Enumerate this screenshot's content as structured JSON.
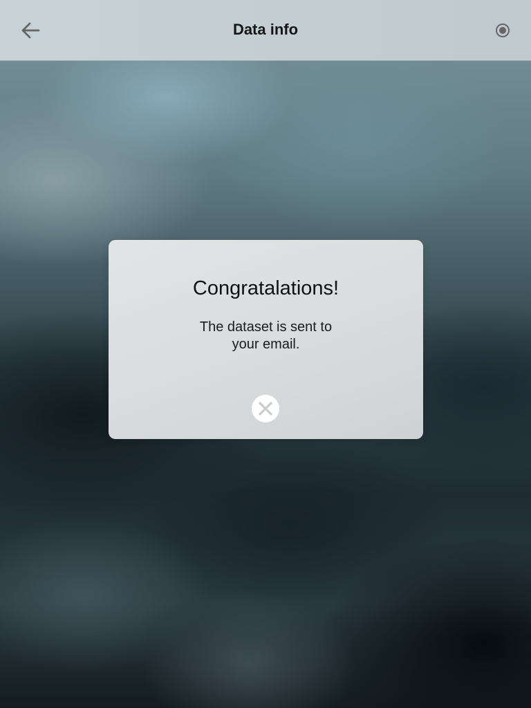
{
  "nav": {
    "title": "Data info",
    "back_icon": "arrow-left-icon",
    "record_icon": "radio-record-icon"
  },
  "dialog": {
    "title": "Congratalations!",
    "message": "The dataset is sent to your email.",
    "close_icon": "close-circle-icon"
  },
  "colors": {
    "nav_background": "#c3cfd3",
    "icon_gray": "#666666",
    "dialog_background": "#dcdfe0",
    "close_x": "#c8cbcc"
  }
}
